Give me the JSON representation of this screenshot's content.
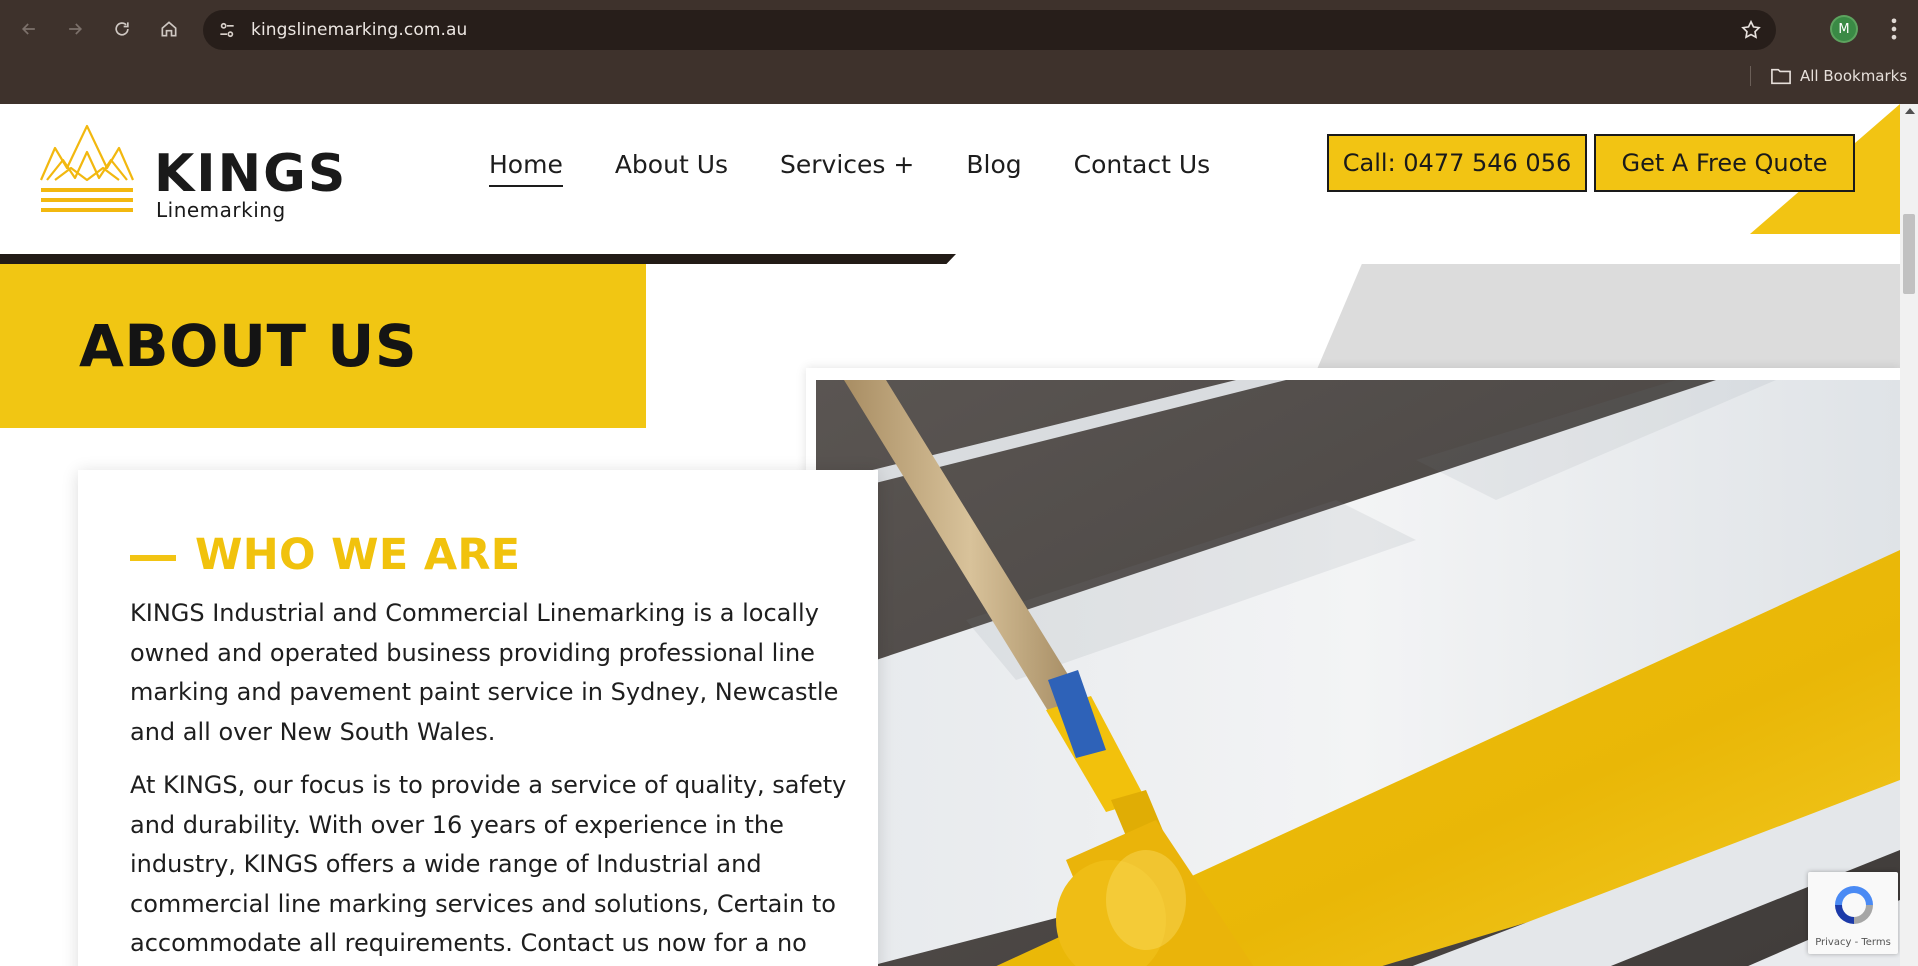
{
  "browser": {
    "url": "kingslinemarking.com.au",
    "bookmarks_label": "All Bookmarks",
    "profile_initial": "M",
    "icons": [
      "back-arrow-icon",
      "forward-arrow-icon",
      "reload-icon",
      "home-icon",
      "site-settings-icon",
      "bookmark-star-icon",
      "kebab-menu-icon",
      "folder-icon"
    ]
  },
  "site": {
    "logo_word": "KINGS",
    "logo_sub": "Linemarking",
    "nav": [
      {
        "label": "Home",
        "active": true
      },
      {
        "label": "About Us"
      },
      {
        "label": "Services +"
      },
      {
        "label": "Blog"
      },
      {
        "label": "Contact Us"
      }
    ],
    "call_label": "Call: 0477 546 056",
    "quote_label": "Get A Free Quote",
    "brand_yellow": "#f2c413",
    "brand_dark": "#221b16"
  },
  "hero": {
    "title": "ABOUT US"
  },
  "about": {
    "heading": "WHO WE ARE",
    "paragraph1": "KINGS Industrial and Commercial Linemarking is a locally owned and operated business providing professional line marking and pavement paint service in Sydney, Newcastle and all over New South Wales.",
    "paragraph2": "At KINGS, our focus is to provide a service of quality, safety and durability. With over 16 years of experience in the industry, KINGS offers a wide range of Industrial and commercial line marking services and solutions, Certain to accommodate all requirements. Contact us now for a no"
  },
  "recaptcha": {
    "text": "Privacy - Terms"
  }
}
